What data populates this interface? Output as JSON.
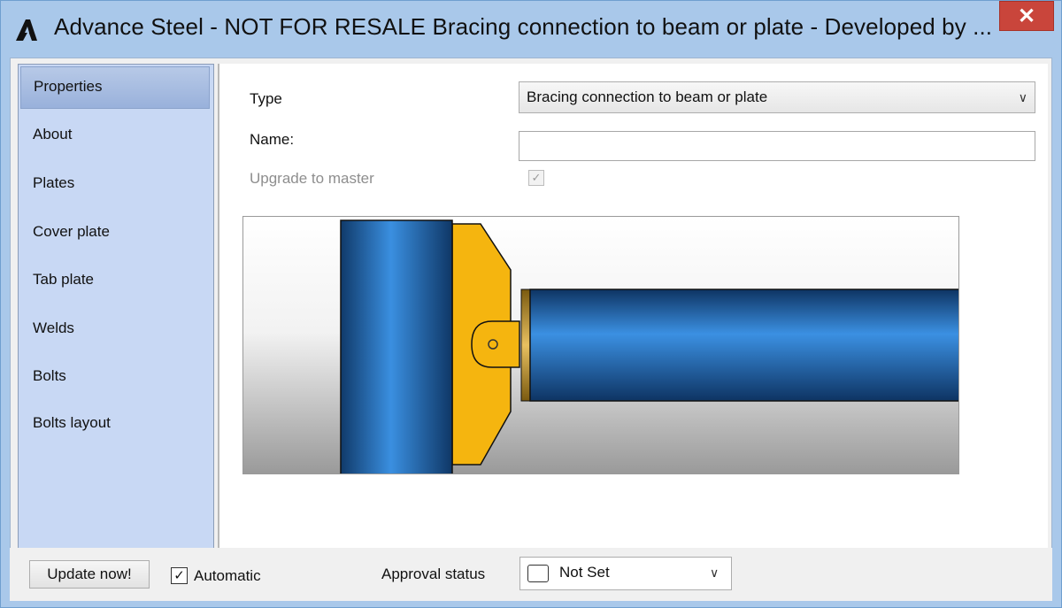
{
  "window": {
    "title": "Advance Steel - NOT FOR RESALE   Bracing connection to beam or plate - Developed by ...",
    "close_label": "✕"
  },
  "sidebar": {
    "items": [
      {
        "label": "Properties",
        "active": true
      },
      {
        "label": "About"
      },
      {
        "label": "Plates"
      },
      {
        "label": "Cover plate"
      },
      {
        "label": "Tab plate"
      },
      {
        "label": "Welds"
      },
      {
        "label": "Bolts"
      },
      {
        "label": "Bolts layout"
      }
    ]
  },
  "form": {
    "type_label": "Type",
    "type_value": "Bracing connection to beam or plate",
    "name_label": "Name:",
    "name_value": "",
    "upgrade_label": "Upgrade to master",
    "upgrade_checked": "✓"
  },
  "bottom": {
    "update_button": "Update now!",
    "automatic_label": "Automatic",
    "automatic_checked": "✓",
    "approval_label": "Approval status",
    "approval_value": "Not Set"
  },
  "colors": {
    "title_bar": "#a9c8ea",
    "sidebar": "#c8d8f4",
    "close_button": "#c9453b",
    "steel_blue": "#2a6fb8",
    "plate_yellow": "#f5b50f"
  },
  "icons": {
    "app": "advance-steel-logo-icon",
    "dropdown": "chevron-down-icon"
  }
}
